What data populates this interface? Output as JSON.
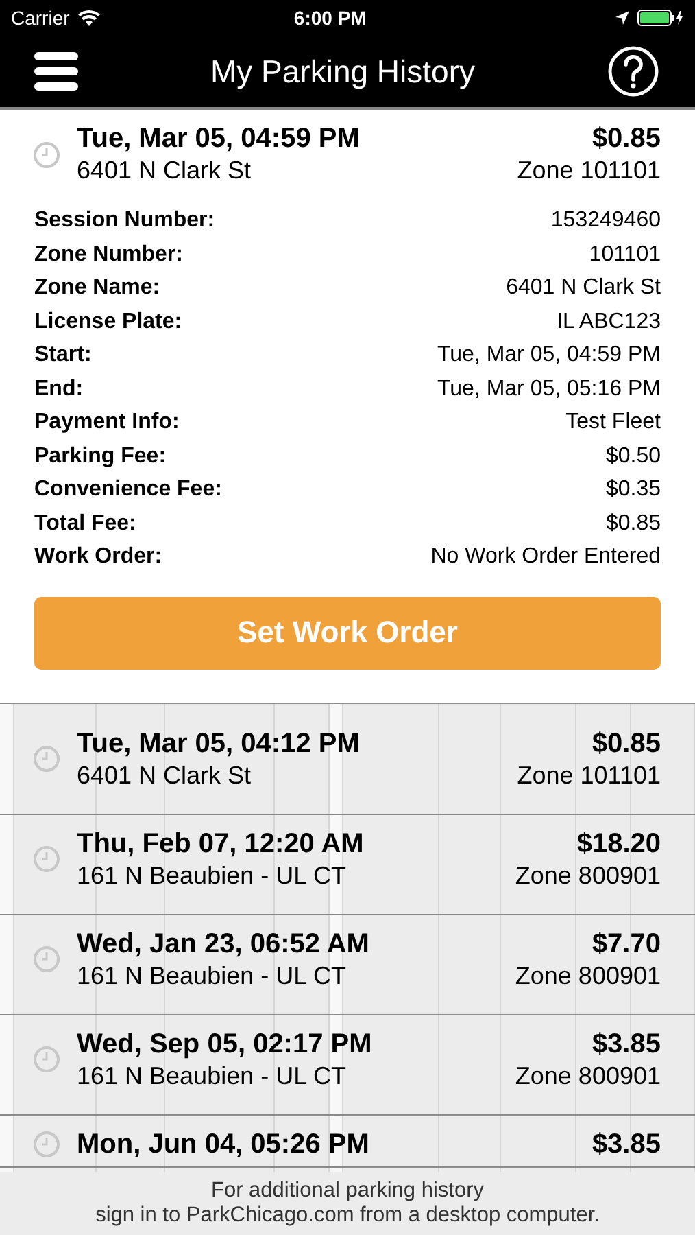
{
  "status_bar": {
    "carrier": "Carrier",
    "time": "6:00 PM"
  },
  "nav_bar": {
    "title": "My Parking History"
  },
  "sessions": [
    {
      "date": "Tue, Mar 05, 04:59 PM",
      "amount": "$0.85",
      "address": "6401 N Clark St",
      "zone": "Zone 101101",
      "expanded": true,
      "details": [
        {
          "label": "Session Number:",
          "value": "153249460"
        },
        {
          "label": "Zone Number:",
          "value": "101101"
        },
        {
          "label": "Zone Name:",
          "value": "6401 N Clark St"
        },
        {
          "label": "License Plate:",
          "value": "IL ABC123"
        },
        {
          "label": "Start:",
          "value": "Tue, Mar 05, 04:59 PM"
        },
        {
          "label": "End:",
          "value": "Tue, Mar 05, 05:16 PM"
        },
        {
          "label": "Payment Info:",
          "value": "Test Fleet"
        },
        {
          "label": "Parking Fee:",
          "value": "$0.50"
        },
        {
          "label": "Convenience Fee:",
          "value": "$0.35"
        },
        {
          "label": "Total Fee:",
          "value": "$0.85"
        },
        {
          "label": "Work Order:",
          "value": "No Work Order Entered"
        }
      ],
      "button": "Set Work Order"
    },
    {
      "date": "Tue, Mar 05, 04:12 PM",
      "amount": "$0.85",
      "address": "6401 N Clark St",
      "zone": "Zone 101101",
      "expanded": false
    },
    {
      "date": "Thu, Feb 07, 12:20 AM",
      "amount": "$18.20",
      "address": "161 N Beaubien - UL CT",
      "zone": "Zone 800901",
      "expanded": false
    },
    {
      "date": "Wed, Jan 23, 06:52 AM",
      "amount": "$7.70",
      "address": "161 N Beaubien - UL CT",
      "zone": "Zone 800901",
      "expanded": false
    },
    {
      "date": "Wed, Sep 05, 02:17 PM",
      "amount": "$3.85",
      "address": "161 N Beaubien - UL CT",
      "zone": "Zone 800901",
      "expanded": false
    },
    {
      "date": "Mon, Jun 04, 05:26 PM",
      "amount": "$3.85",
      "expanded": false
    }
  ],
  "footer": {
    "lines": [
      "For additional parking history",
      "sign in to ParkChicago.com from a desktop computer."
    ]
  }
}
